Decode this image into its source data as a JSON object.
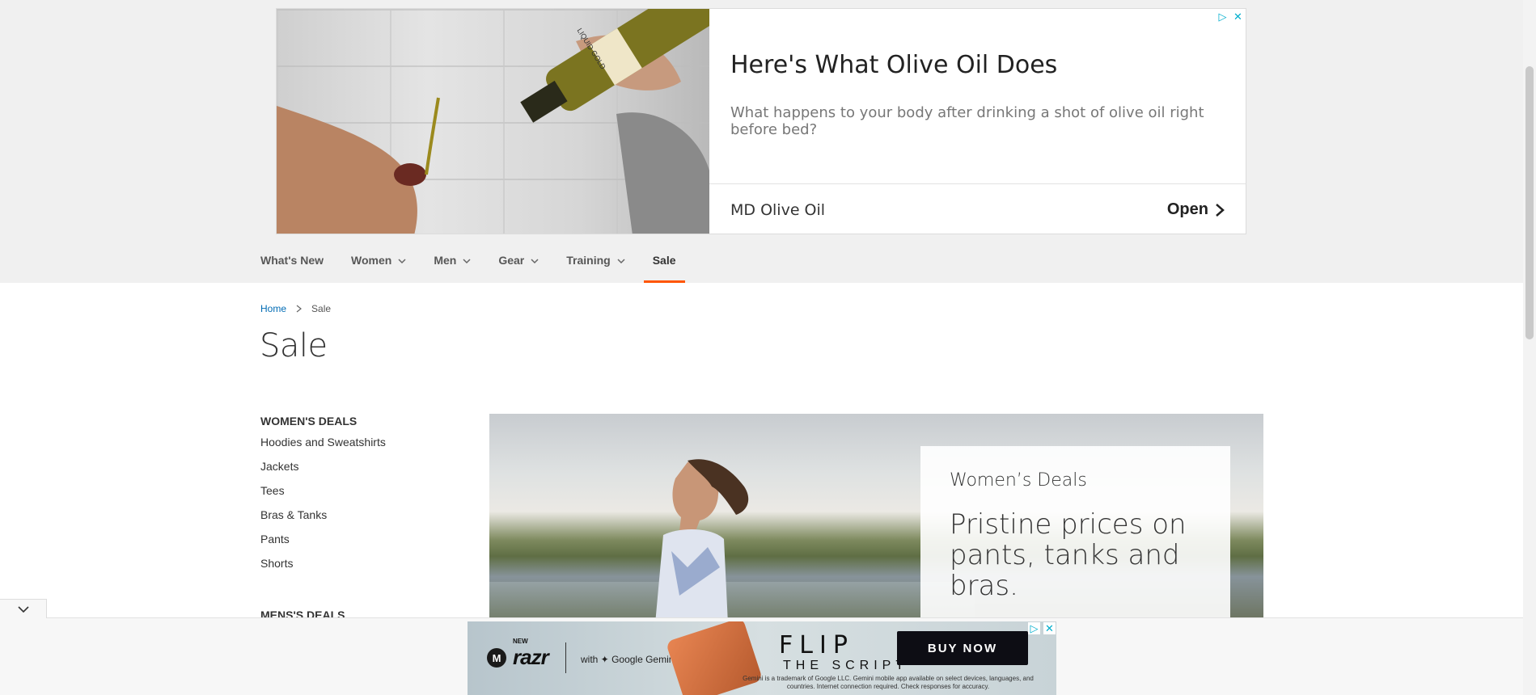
{
  "top_ad": {
    "headline": "Here's What Olive Oil Does",
    "description": "What happens to your body after drinking a shot of olive oil right before bed?",
    "advertiser": "MD Olive Oil",
    "cta": "Open",
    "bottle_label": "LIQUID GOLD"
  },
  "nav": {
    "items": [
      {
        "label": "What's New",
        "has_dropdown": false
      },
      {
        "label": "Women",
        "has_dropdown": true
      },
      {
        "label": "Men",
        "has_dropdown": true
      },
      {
        "label": "Gear",
        "has_dropdown": true
      },
      {
        "label": "Training",
        "has_dropdown": true
      },
      {
        "label": "Sale",
        "has_dropdown": false,
        "active": true
      }
    ],
    "active_color": "#ff5501"
  },
  "breadcrumb": {
    "home": "Home",
    "current": "Sale"
  },
  "page": {
    "title": "Sale"
  },
  "sidebar": {
    "womens_heading": "WOMEN'S DEALS",
    "womens_items": [
      "Hoodies and Sweatshirts",
      "Jackets",
      "Tees",
      "Bras & Tanks",
      "Pants",
      "Shorts"
    ],
    "mens_heading": "MENS'S DEALS"
  },
  "hero": {
    "subtitle": "Women’s Deals",
    "title": "Pristine prices on pants, tanks and bras."
  },
  "bottom_ad": {
    "brand_new": "NEW",
    "brand_name": "razr",
    "partner": "with ✦ Google Gemini",
    "headline_top": "FLIP",
    "headline_bottom": "THE SCRIPT",
    "fine_print": "Gemini is a trademark of Google LLC. Gemini mobile app available on select devices, languages, and countries. Internet connection required. Check responses for accuracy.",
    "cta": "BUY NOW"
  },
  "icons": {
    "chevron_down": "chevron-down-icon",
    "chevron_right": "chevron-right-icon",
    "adchoices": "adchoices-icon",
    "close": "close-icon"
  }
}
